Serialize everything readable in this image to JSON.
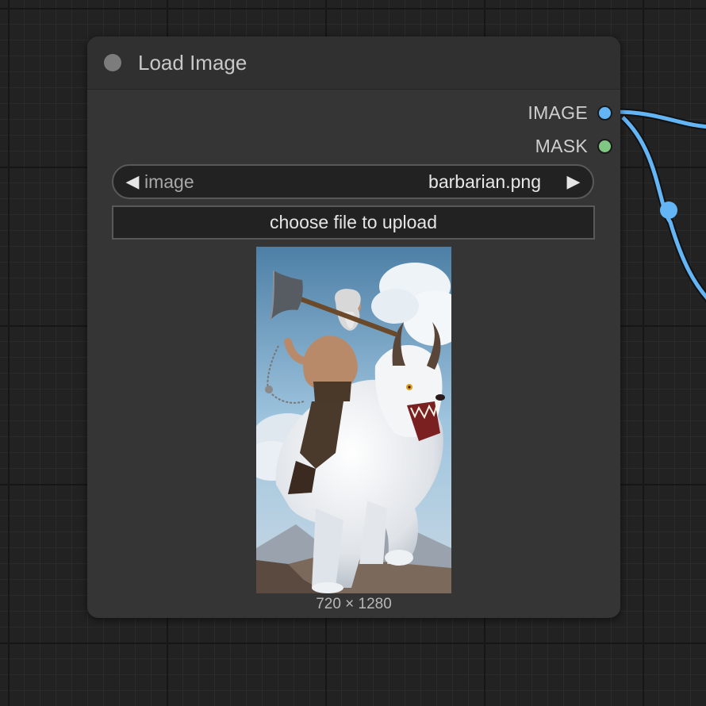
{
  "node": {
    "title": "Load Image",
    "outputs": [
      {
        "label": "IMAGE",
        "color": "#64b5f6"
      },
      {
        "label": "MASK",
        "color": "#81c784"
      }
    ],
    "widgets": {
      "image_combo": {
        "name": "image",
        "value": "barbarian.png",
        "prev_icon": "◀",
        "next_icon": "▶"
      },
      "upload_button": {
        "label": "choose file to upload"
      }
    },
    "preview": {
      "description_icon": "image-preview",
      "dimensions": "720 × 1280"
    }
  },
  "colors": {
    "link_image": "#64b5f6",
    "canvas_bg": "#222222",
    "node_bg": "#353535"
  }
}
